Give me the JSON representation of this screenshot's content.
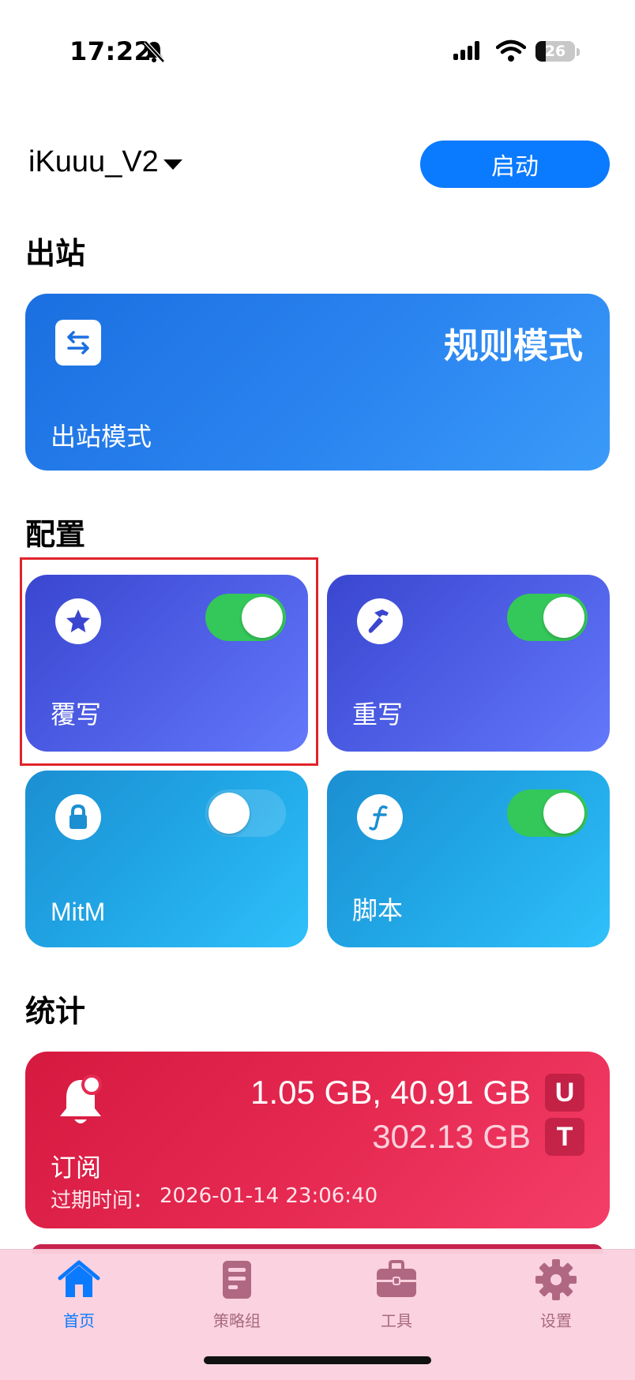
{
  "status_bar": {
    "time": "17:22",
    "battery_level": "26",
    "battery_fraction": 0.26
  },
  "header": {
    "profile_name": "iKuuu_V2",
    "start_label": "启动"
  },
  "sections": {
    "outbound": "出站",
    "config": "配置",
    "stats": "统计"
  },
  "outbound_card": {
    "mode_value": "规则模式",
    "label": "出站模式"
  },
  "config_tiles": [
    {
      "label": "覆写",
      "enabled": true,
      "icon": "star-icon"
    },
    {
      "label": "重写",
      "enabled": true,
      "icon": "hammer-icon"
    },
    {
      "label": "MitM",
      "enabled": false,
      "icon": "lock-icon"
    },
    {
      "label": "脚本",
      "enabled": true,
      "icon": "function-icon"
    }
  ],
  "stats_card": {
    "upload_download": "1.05 GB, 40.91 GB",
    "upload_badge": "U",
    "total": "302.13 GB",
    "total_badge": "T",
    "label": "订阅",
    "expire_label": "过期时间：",
    "expire_value": "2026-01-14 23:06:40"
  },
  "tab_bar": [
    {
      "label": "首页",
      "icon": "home-icon",
      "active": true
    },
    {
      "label": "策略组",
      "icon": "document-icon",
      "active": false
    },
    {
      "label": "工具",
      "icon": "toolbox-icon",
      "active": false
    },
    {
      "label": "设置",
      "icon": "gear-icon",
      "active": false
    }
  ],
  "colors": {
    "accent": "#0a7aff",
    "toggle_on": "#34c759",
    "stats_red": "#e62a52",
    "highlight": "#e0232a"
  }
}
